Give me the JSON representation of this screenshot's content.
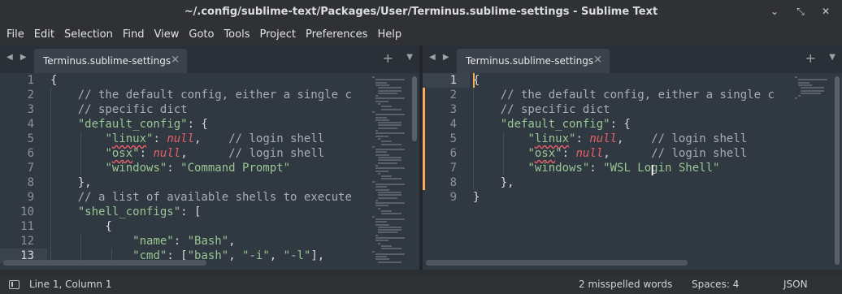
{
  "window": {
    "title": "~/.config/sublime-text/Packages/User/Terminus.sublime-settings - Sublime Text",
    "minimize_glyph": "⌄",
    "restore_glyph": "⤡",
    "close_glyph": "✕"
  },
  "menu": [
    "File",
    "Edit",
    "Selection",
    "Find",
    "View",
    "Goto",
    "Tools",
    "Project",
    "Preferences",
    "Help"
  ],
  "left_pane": {
    "tab_label": "Terminus.sublime-settings",
    "line_numbers": [
      "1",
      "2",
      "3",
      "4",
      "5",
      "6",
      "7",
      "8",
      "9",
      "10",
      "11",
      "12",
      "13"
    ],
    "current_line": "13",
    "lines": [
      "{",
      "    // the default config, either a single c",
      "    // specific dict",
      "    \"default_config\": {",
      "        \"linux\": null,    // login shell",
      "        \"osx\": null,      // login shell",
      "        \"windows\": \"Command Prompt\"",
      "    },",
      "    // a list of available shells to execute",
      "    \"shell_configs\": [",
      "        {",
      "            \"name\": \"Bash\",",
      "            \"cmd\": [\"bash\", \"-i\", \"-l\"],"
    ]
  },
  "right_pane": {
    "tab_label": "Terminus.sublime-settings",
    "line_numbers": [
      "1",
      "2",
      "3",
      "4",
      "5",
      "6",
      "7",
      "8",
      "9"
    ],
    "current_line": "1",
    "lines": [
      "{",
      "    // the default config, either a single c",
      "    // specific dict",
      "    \"default_config\": {",
      "        \"linux\": null,    // login shell",
      "        \"osx\": null,      // login shell",
      "        \"windows\": \"WSL Login Shell\"",
      "    },",
      "}"
    ]
  },
  "tab_icons": {
    "nav": "◀ ▶",
    "close": "×",
    "new_tab": "+",
    "tab_menu": "▼"
  },
  "status": {
    "position": "Line 1, Column 1",
    "spelling": "2 misspelled words",
    "indent": "Spaces: 4",
    "syntax": "JSON"
  },
  "colors": {
    "editor_bg": "#303841",
    "string": "#99c794",
    "constant": "#ec5f67",
    "comment": "#a7adba",
    "modified_marker": "#f9ae58"
  }
}
